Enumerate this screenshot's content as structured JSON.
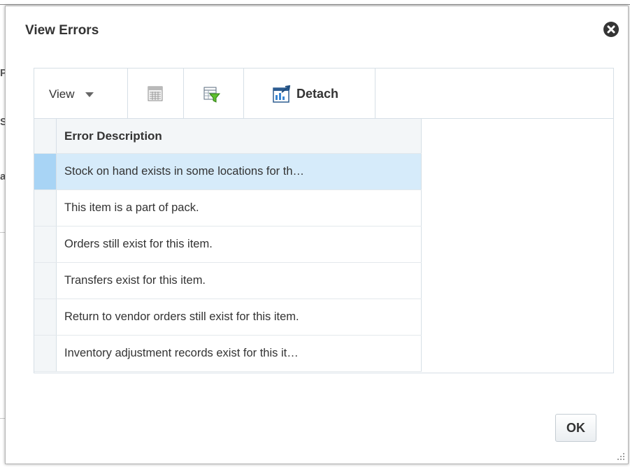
{
  "dialog": {
    "title": "View Errors"
  },
  "toolbar": {
    "view_label": "View",
    "detach_label": "Detach"
  },
  "table": {
    "column_header": "Error Description",
    "rows": [
      "Stock on hand exists in some locations for th…",
      "This item is a part of pack.",
      "Orders still exist for this item.",
      "Transfers exist for this item.",
      "Return to vendor orders still exist for this item.",
      "Inventory adjustment records exist for this it…"
    ],
    "selected_row_index": 0
  },
  "buttons": {
    "ok_label": "OK"
  },
  "icons": {
    "close": "close-icon",
    "export": "export-to-excel-icon",
    "filter": "query-by-example-filter-icon",
    "detach": "detach-icon",
    "resize": "resize-grip-icon"
  },
  "colors": {
    "selected_row": "#d6ebfa",
    "selected_row_header": "#a8d4f5",
    "border": "#d6dfe6"
  }
}
